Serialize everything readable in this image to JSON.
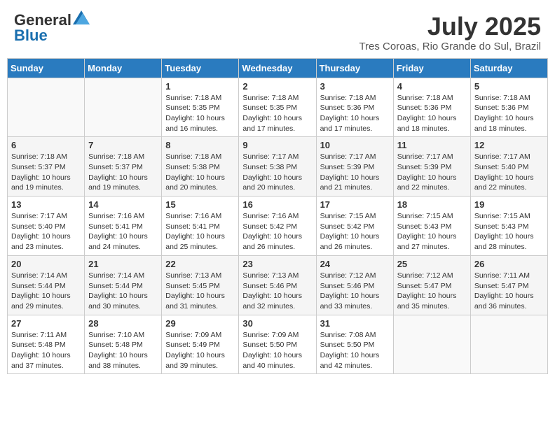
{
  "logo": {
    "general": "General",
    "blue": "Blue"
  },
  "title": "July 2025",
  "location": "Tres Coroas, Rio Grande do Sul, Brazil",
  "headers": [
    "Sunday",
    "Monday",
    "Tuesday",
    "Wednesday",
    "Thursday",
    "Friday",
    "Saturday"
  ],
  "weeks": [
    [
      {
        "day": "",
        "info": ""
      },
      {
        "day": "",
        "info": ""
      },
      {
        "day": "1",
        "info": "Sunrise: 7:18 AM\nSunset: 5:35 PM\nDaylight: 10 hours and 16 minutes."
      },
      {
        "day": "2",
        "info": "Sunrise: 7:18 AM\nSunset: 5:35 PM\nDaylight: 10 hours and 17 minutes."
      },
      {
        "day": "3",
        "info": "Sunrise: 7:18 AM\nSunset: 5:36 PM\nDaylight: 10 hours and 17 minutes."
      },
      {
        "day": "4",
        "info": "Sunrise: 7:18 AM\nSunset: 5:36 PM\nDaylight: 10 hours and 18 minutes."
      },
      {
        "day": "5",
        "info": "Sunrise: 7:18 AM\nSunset: 5:36 PM\nDaylight: 10 hours and 18 minutes."
      }
    ],
    [
      {
        "day": "6",
        "info": "Sunrise: 7:18 AM\nSunset: 5:37 PM\nDaylight: 10 hours and 19 minutes."
      },
      {
        "day": "7",
        "info": "Sunrise: 7:18 AM\nSunset: 5:37 PM\nDaylight: 10 hours and 19 minutes."
      },
      {
        "day": "8",
        "info": "Sunrise: 7:18 AM\nSunset: 5:38 PM\nDaylight: 10 hours and 20 minutes."
      },
      {
        "day": "9",
        "info": "Sunrise: 7:17 AM\nSunset: 5:38 PM\nDaylight: 10 hours and 20 minutes."
      },
      {
        "day": "10",
        "info": "Sunrise: 7:17 AM\nSunset: 5:39 PM\nDaylight: 10 hours and 21 minutes."
      },
      {
        "day": "11",
        "info": "Sunrise: 7:17 AM\nSunset: 5:39 PM\nDaylight: 10 hours and 22 minutes."
      },
      {
        "day": "12",
        "info": "Sunrise: 7:17 AM\nSunset: 5:40 PM\nDaylight: 10 hours and 22 minutes."
      }
    ],
    [
      {
        "day": "13",
        "info": "Sunrise: 7:17 AM\nSunset: 5:40 PM\nDaylight: 10 hours and 23 minutes."
      },
      {
        "day": "14",
        "info": "Sunrise: 7:16 AM\nSunset: 5:41 PM\nDaylight: 10 hours and 24 minutes."
      },
      {
        "day": "15",
        "info": "Sunrise: 7:16 AM\nSunset: 5:41 PM\nDaylight: 10 hours and 25 minutes."
      },
      {
        "day": "16",
        "info": "Sunrise: 7:16 AM\nSunset: 5:42 PM\nDaylight: 10 hours and 26 minutes."
      },
      {
        "day": "17",
        "info": "Sunrise: 7:15 AM\nSunset: 5:42 PM\nDaylight: 10 hours and 26 minutes."
      },
      {
        "day": "18",
        "info": "Sunrise: 7:15 AM\nSunset: 5:43 PM\nDaylight: 10 hours and 27 minutes."
      },
      {
        "day": "19",
        "info": "Sunrise: 7:15 AM\nSunset: 5:43 PM\nDaylight: 10 hours and 28 minutes."
      }
    ],
    [
      {
        "day": "20",
        "info": "Sunrise: 7:14 AM\nSunset: 5:44 PM\nDaylight: 10 hours and 29 minutes."
      },
      {
        "day": "21",
        "info": "Sunrise: 7:14 AM\nSunset: 5:44 PM\nDaylight: 10 hours and 30 minutes."
      },
      {
        "day": "22",
        "info": "Sunrise: 7:13 AM\nSunset: 5:45 PM\nDaylight: 10 hours and 31 minutes."
      },
      {
        "day": "23",
        "info": "Sunrise: 7:13 AM\nSunset: 5:46 PM\nDaylight: 10 hours and 32 minutes."
      },
      {
        "day": "24",
        "info": "Sunrise: 7:12 AM\nSunset: 5:46 PM\nDaylight: 10 hours and 33 minutes."
      },
      {
        "day": "25",
        "info": "Sunrise: 7:12 AM\nSunset: 5:47 PM\nDaylight: 10 hours and 35 minutes."
      },
      {
        "day": "26",
        "info": "Sunrise: 7:11 AM\nSunset: 5:47 PM\nDaylight: 10 hours and 36 minutes."
      }
    ],
    [
      {
        "day": "27",
        "info": "Sunrise: 7:11 AM\nSunset: 5:48 PM\nDaylight: 10 hours and 37 minutes."
      },
      {
        "day": "28",
        "info": "Sunrise: 7:10 AM\nSunset: 5:48 PM\nDaylight: 10 hours and 38 minutes."
      },
      {
        "day": "29",
        "info": "Sunrise: 7:09 AM\nSunset: 5:49 PM\nDaylight: 10 hours and 39 minutes."
      },
      {
        "day": "30",
        "info": "Sunrise: 7:09 AM\nSunset: 5:50 PM\nDaylight: 10 hours and 40 minutes."
      },
      {
        "day": "31",
        "info": "Sunrise: 7:08 AM\nSunset: 5:50 PM\nDaylight: 10 hours and 42 minutes."
      },
      {
        "day": "",
        "info": ""
      },
      {
        "day": "",
        "info": ""
      }
    ]
  ]
}
